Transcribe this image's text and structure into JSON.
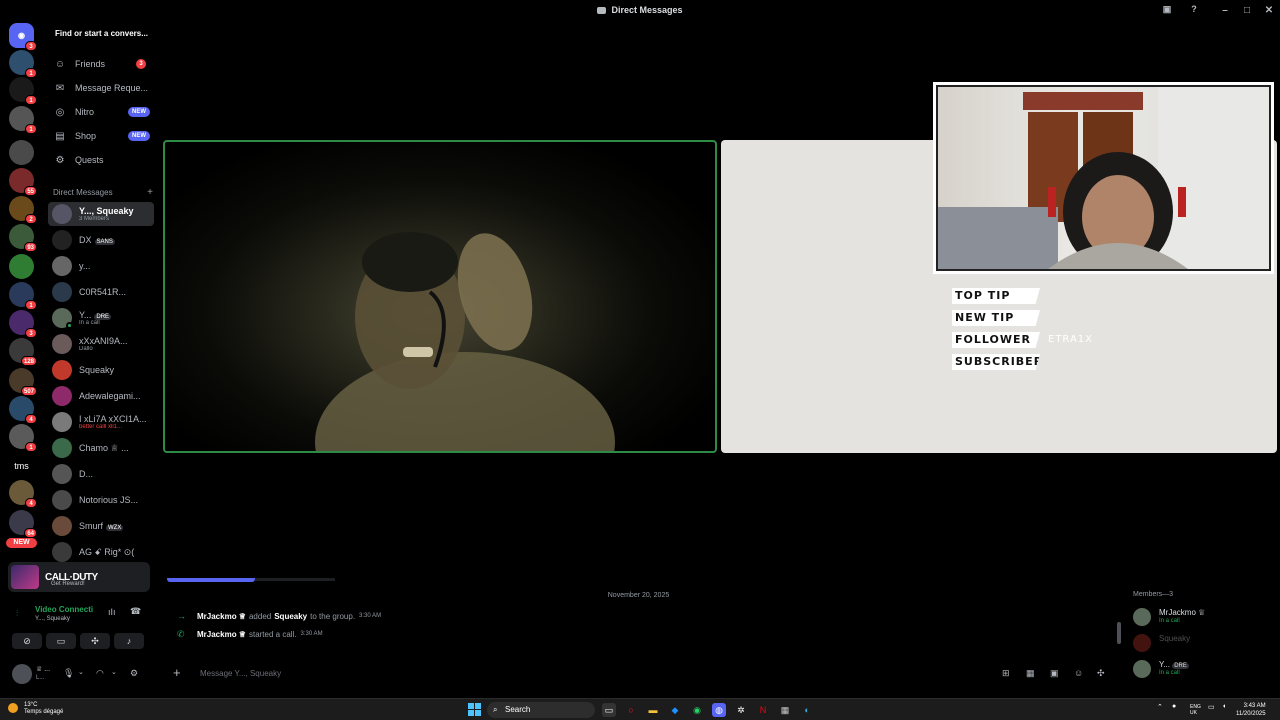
{
  "titlebar": {
    "title": "Direct Messages"
  },
  "rail": {
    "badges": [
      "3",
      "1",
      "1",
      "1",
      "55",
      "2",
      "93",
      "1",
      "3",
      "128",
      "507",
      "4",
      "1",
      "4",
      "10",
      "64"
    ],
    "tms_label": "tms",
    "new_label": "NEW"
  },
  "sidebar": {
    "search": "Find or start a convers...",
    "nav": [
      {
        "label": "Friends",
        "count": "3"
      },
      {
        "label": "Message Reque..."
      },
      {
        "label": "Nitro",
        "pill": "NEW"
      },
      {
        "label": "Shop",
        "pill": "NEW"
      },
      {
        "label": "Quests"
      }
    ],
    "dm_header": "Direct Messages",
    "dms": [
      {
        "name": "Y..., Squeaky",
        "sub": "3 Members"
      },
      {
        "name": "DX",
        "tag": "SANS"
      },
      {
        "name": "y..."
      },
      {
        "name": "C0R541R..."
      },
      {
        "name": "Y...",
        "tag": "DRE",
        "sub": "In a call"
      },
      {
        "name": "xXxANI9A...",
        "sub": "Dallo"
      },
      {
        "name": "Squeaky"
      },
      {
        "name": "Adewalegami..."
      },
      {
        "name": "I xLi7A xXCI1A...",
        "sub": "better calll xll1..."
      },
      {
        "name": "Chamo ♕ ..."
      },
      {
        "name": "D..."
      },
      {
        "name": "Notorious JS..."
      },
      {
        "name": "Smurf",
        "tag": "WZX"
      },
      {
        "name": "AG ꗃ Rig* ⊙("
      }
    ]
  },
  "promo": {
    "title": "CALL·DUTY",
    "sub": "Get Reward!"
  },
  "voice": {
    "title": "Video Connecti",
    "sub": "Y..., Squeaky"
  },
  "user": {
    "name": "♕ ...",
    "status": "L..."
  },
  "overlay": {
    "alerts": [
      {
        "label": "TOP TIP",
        "value": ""
      },
      {
        "label": "NEW TIP",
        "value": ""
      },
      {
        "label": "FOLLOWER",
        "value": "ETRA1X"
      },
      {
        "label": "SUBSCRIBER",
        "value": ""
      }
    ]
  },
  "chat": {
    "date": "November 20, 2025",
    "messages": [
      {
        "who": "MrJackmo ♕",
        "action": "added",
        "target": "Squeaky",
        "rest": "to the group.",
        "time": "3:30 AM"
      },
      {
        "who": "MrJackmo ♕",
        "action": "started a call.",
        "target": "",
        "rest": "",
        "time": "3:30 AM"
      }
    ],
    "placeholder": "Message Y..., Squeaky"
  },
  "members": {
    "header": "Members—3",
    "list": [
      {
        "name": "MrJackmo ♕",
        "sub": "In a call"
      },
      {
        "name": "Squeaky",
        "sub": ""
      },
      {
        "name": "Y...",
        "tag": "DRE",
        "sub": "In a call"
      }
    ]
  },
  "taskbar": {
    "temp": "13°C",
    "weather": "Temps dégagé",
    "search": "Search",
    "lang": "ENG",
    "region": "UK",
    "time": "3:43 AM",
    "date": "11/20/2025"
  },
  "colors": {
    "accent": "#5865f2",
    "green": "#23a55a",
    "red": "#f23f43"
  }
}
